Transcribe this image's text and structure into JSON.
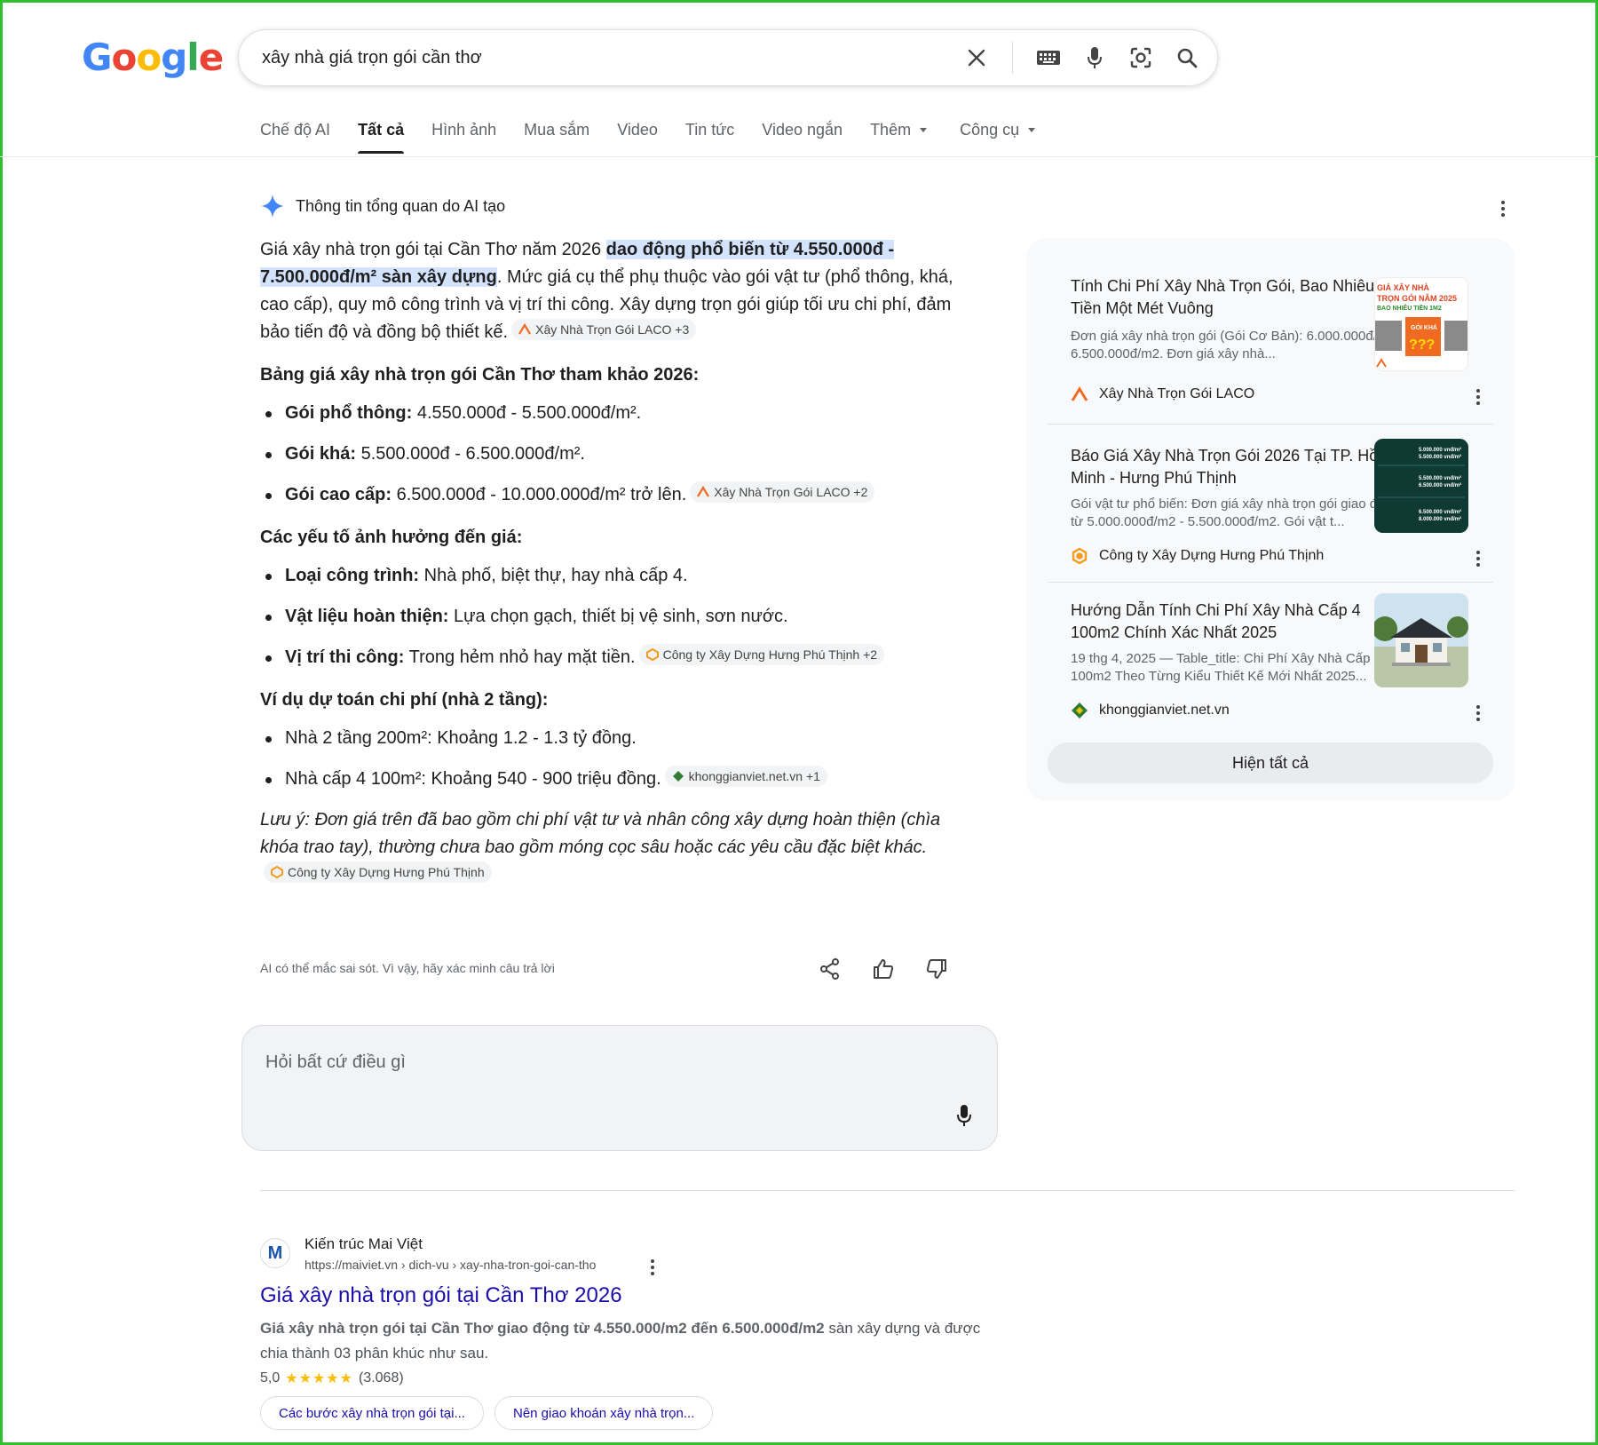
{
  "search": {
    "query": "xây nhà giá trọn gói cần thơ"
  },
  "tabs": [
    {
      "label": "Chế độ AI"
    },
    {
      "label": "Tất cả"
    },
    {
      "label": "Hình ảnh"
    },
    {
      "label": "Mua sắm"
    },
    {
      "label": "Video"
    },
    {
      "label": "Tin tức"
    },
    {
      "label": "Video ngắn"
    },
    {
      "label": "Thêm"
    },
    {
      "label": "Công cụ"
    }
  ],
  "ai_overview": {
    "header": "Thông tin tổng quan do AI tạo",
    "intro_pre": "Giá xây nhà trọn gói tại Cần Thơ năm 2026 ",
    "intro_hl": "dao động phổ biến từ 4.550.000đ - 7.500.000đ/m² sàn xây dựng",
    "intro_post": ". Mức giá cụ thể phụ thuộc vào gói vật tư (phổ thông, khá, cao cấp), quy mô công trình và vị trí thi công. Xây dựng trọn gói giúp tối ưu chi phí, đảm bảo tiến độ và đồng bộ thiết kế.",
    "intro_chip": "Xây Nhà Trọn Gói LACO +3",
    "price_heading": "Bảng giá xây nhà trọn gói Cần Thơ tham khảo 2026:",
    "prices": [
      {
        "label": "Gói phổ thông:",
        "text": " 4.550.000đ - 5.500.000đ/m²."
      },
      {
        "label": "Gói khá:",
        "text": " 5.500.000đ - 6.500.000đ/m²."
      },
      {
        "label": "Gói cao cấp:",
        "text": " 6.500.000đ - 10.000.000đ/m² trở lên.",
        "chip": "Xây Nhà Trọn Gói LACO +2"
      }
    ],
    "factor_heading": "Các yếu tố ảnh hưởng đến giá:",
    "factors": [
      {
        "label": "Loại công trình:",
        "text": " Nhà phố, biệt thự, hay nhà cấp 4."
      },
      {
        "label": "Vật liệu hoàn thiện:",
        "text": " Lựa chọn gạch, thiết bị vệ sinh, sơn nước."
      },
      {
        "label": "Vị trí thi công:",
        "text": " Trong hẻm nhỏ hay mặt tiền.",
        "chip": "Công ty Xây Dựng Hưng Phú Thịnh +2"
      }
    ],
    "example_heading": "Ví dụ dự toán chi phí (nhà 2 tầng):",
    "examples": [
      {
        "text": "Nhà 2 tầng 200m²: Khoảng 1.2 - 1.3 tỷ đồng."
      },
      {
        "text": "Nhà cấp 4 100m²: Khoảng 540 - 900 triệu đồng.",
        "chip": "khonggianviet.net.vn +1"
      }
    ],
    "note": "Lưu ý: Đơn giá trên đã bao gồm chi phí vật tư và nhân công xây dựng hoàn thiện (chìa khóa trao tay), thường chưa bao gồm móng cọc sâu hoặc các yêu cầu đặc biệt khác.",
    "note_chip": "Công ty Xây Dựng Hưng Phú Thịnh",
    "disclaimer": "AI có thể mắc sai sót. Vì vậy, hãy xác minh câu trả lời"
  },
  "ask": {
    "placeholder": "Hỏi bất cứ điều gì"
  },
  "sources": [
    {
      "title": "Tính Chi Phí Xây Nhà Trọn Gói, Bao Nhiêu Tiền Một Mét Vuông",
      "desc": "Đơn giá xây nhà trọn gói (Gói Cơ Bản): 6.000.000đ/m2 – 6.500.000đ/m2. Đơn giá xây nhà...",
      "site": "Xây Nhà Trọn Gói LACO",
      "thumb_lines": [
        "GIÁ XÂY NHÀ",
        "TRỌN GÓI NĂM 2025",
        "BAO NHIÊU TIỀN 1M2",
        "GÓI KHÁ",
        "???"
      ]
    },
    {
      "title": "Báo Giá Xây Nhà Trọn Gói 2026 Tại TP. Hồ Chí Minh - Hưng Phú Thịnh",
      "desc": "Gói vật tư phổ biến: Đơn giá xây nhà trọn gói giao động từ 5.000.000đ/m2 - 5.500.000đ/m2. Gói vật t...",
      "site": "Công ty Xây Dựng Hưng Phú Thịnh",
      "thumb_lines": [
        "5.000.000 vnđ/m²",
        "5.500.000 vnđ/m²",
        "5.500.000 vnđ/m²",
        "6.500.000 vnđ/m²",
        "6.500.000 vnđ/m²",
        "8.000.000 vnđ/m²"
      ]
    },
    {
      "title": "Hướng Dẫn Tính Chi Phí Xây Nhà Cấp 4 100m2 Chính Xác Nhất 2025",
      "desc": "19 thg 4, 2025 — Table_title: Chi Phí Xây Nhà Cấp 4 100m2 Theo Từng Kiểu Thiết Kế Mới Nhất 2025...",
      "site": "khonggianviet.net.vn"
    }
  ],
  "show_all": "Hiện tất cả",
  "result": {
    "site": "Kiến trúc Mai Việt",
    "url": "https://maiviet.vn › dich-vu › xay-nha-tron-goi-can-tho",
    "title": "Giá xây nhà trọn gói tại Cần Thơ 2026",
    "snippet_bold": "Giá xây nhà trọn gói tại Cần Thơ giao động từ 4.550.000/m2 đến 6.500.000đ/m2",
    "snippet_rest": " sàn xây dựng và được chia thành 03 phân khúc như sau.",
    "rating": "5,0",
    "stars": "★★★★★",
    "reviews": "(3.068)",
    "links": [
      "Các bước xây nhà trọn gói tại...",
      "Nên giao khoán xây nhà trọn..."
    ]
  },
  "colors": {
    "link": "#1a0dab",
    "highlight": "#d3e3fd",
    "frame": "#2fbf2f"
  }
}
